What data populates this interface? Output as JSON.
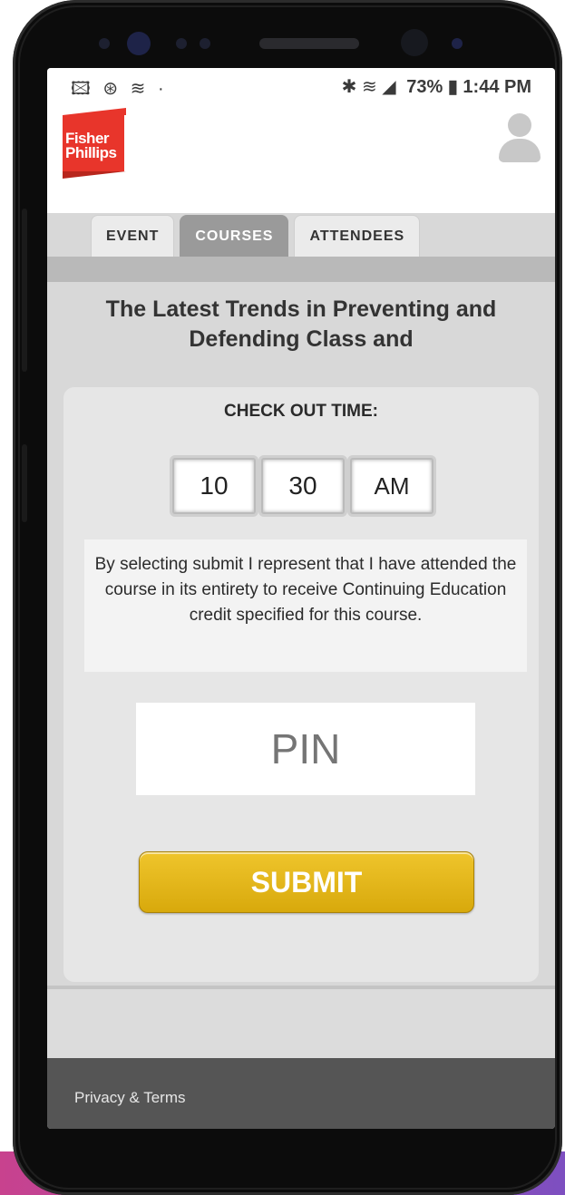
{
  "status_bar": {
    "left_icons": "🖾 ⊛ ≋ ·",
    "signal": "✱ ≋ ◢",
    "battery": "73%",
    "time": "1:44 PM"
  },
  "header": {
    "logo_line1": "Fisher",
    "logo_line2": "Phillips",
    "brand_color": "#e8352b"
  },
  "tabs": [
    {
      "label": "EVENT",
      "active": false
    },
    {
      "label": "COURSES",
      "active": true
    },
    {
      "label": "ATTENDEES",
      "active": false
    }
  ],
  "course": {
    "title": "The Latest Trends in Preventing and Defending Class and"
  },
  "checkout": {
    "label": "CHECK OUT TIME:",
    "hour": "10",
    "minute": "30",
    "meridiem": "AM"
  },
  "consent_text": "By selecting submit I represent that I have attended the course in its entirety to receive Continuing Education credit specified for this course.",
  "pin": {
    "placeholder": "PIN",
    "value": ""
  },
  "submit_label": "SUBMIT",
  "accent_color": "#e0b318",
  "footer": {
    "privacy_link": "Privacy & Terms"
  }
}
